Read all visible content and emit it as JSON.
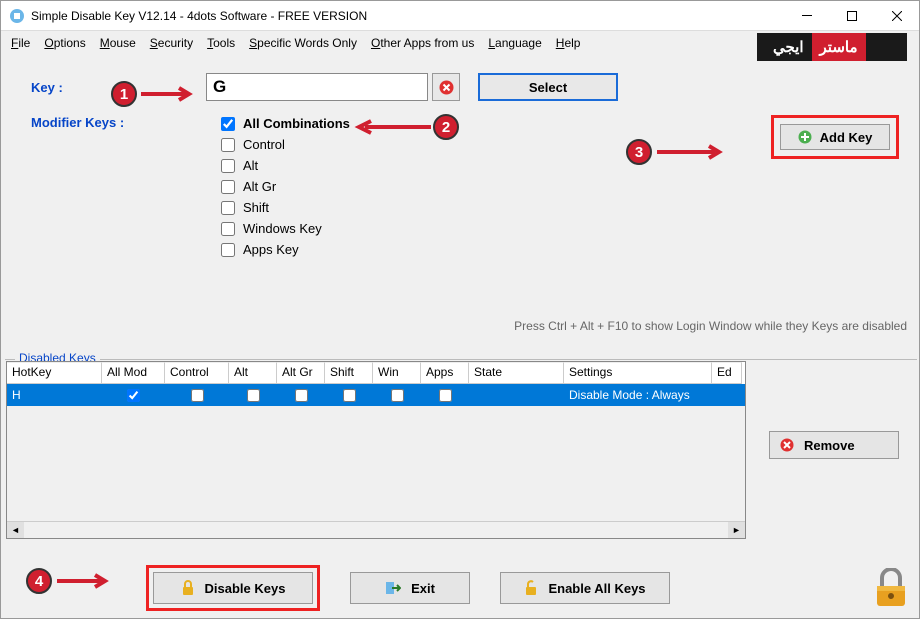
{
  "titlebar": {
    "title": "Simple Disable Key V12.14 - 4dots Software - FREE VERSION"
  },
  "menubar": {
    "items": [
      "File",
      "Options",
      "Mouse",
      "Security",
      "Tools",
      "Specific Words Only",
      "Other Apps from us",
      "Language",
      "Help"
    ]
  },
  "logo": {
    "red": "ماستر",
    "black": "ايجي"
  },
  "key_section": {
    "label": "Key :",
    "value": "G",
    "select_button": "Select"
  },
  "modifiers": {
    "label": "Modifier Keys :",
    "items": [
      {
        "label": "All Combinations",
        "checked": true,
        "bold": true
      },
      {
        "label": "Control",
        "checked": false
      },
      {
        "label": "Alt",
        "checked": false
      },
      {
        "label": "Alt Gr",
        "checked": false
      },
      {
        "label": "Shift",
        "checked": false
      },
      {
        "label": "Windows Key",
        "checked": false
      },
      {
        "label": "Apps Key",
        "checked": false
      }
    ]
  },
  "add_key_button": "Add Key",
  "hint": "Press Ctrl + Alt + F10 to show Login Window while they Keys are disabled",
  "group_title": "Disabled Keys",
  "table": {
    "headers": [
      "HotKey",
      "All Mod",
      "Control",
      "Alt",
      "Alt Gr",
      "Shift",
      "Win",
      "Apps",
      "State",
      "Settings",
      "Ed"
    ],
    "row": {
      "hotkey": "H",
      "allmod": true,
      "control": false,
      "alt": false,
      "altgr": false,
      "shift": false,
      "win": false,
      "apps": false,
      "state": "",
      "settings": "Disable Mode : Always"
    }
  },
  "remove_button": "Remove",
  "bottom": {
    "disable": "Disable Keys",
    "exit": "Exit",
    "enable": "Enable All Keys"
  },
  "annotations": {
    "n1": "1",
    "n2": "2",
    "n3": "3",
    "n4": "4"
  }
}
